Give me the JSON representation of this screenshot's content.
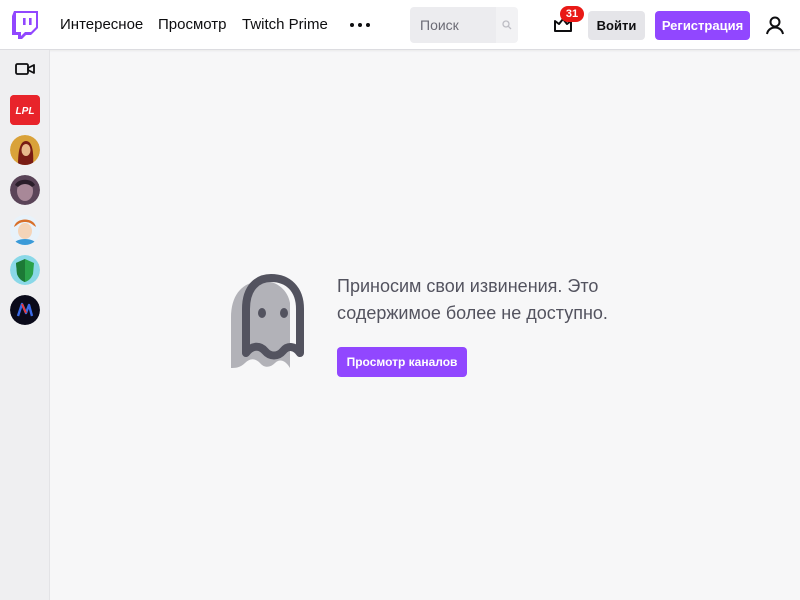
{
  "nav": {
    "links": [
      "Интересное",
      "Просмотр",
      "Twitch Prime"
    ],
    "search_placeholder": "Поиск",
    "notification_count": "31",
    "login_label": "Войти",
    "signup_label": "Регистрация"
  },
  "sidebar": {
    "channels": [
      {
        "icon": "lpl-logo",
        "text": "LPL",
        "color": "#e8242b"
      },
      {
        "icon": "avatar-woman-red",
        "color": "#c83a2a"
      },
      {
        "icon": "avatar-dark-portrait",
        "color": "#6a4a6a"
      },
      {
        "icon": "avatar-anime-blue",
        "color": "#3aa0d8"
      },
      {
        "icon": "avatar-green-shield",
        "color": "#2aa24a"
      },
      {
        "icon": "avatar-dark-logo",
        "color": "#0a0a1a"
      }
    ]
  },
  "main": {
    "message": "Приносим свои извинения. Это содержимое более не доступно.",
    "browse_label": "Просмотр каналов"
  },
  "colors": {
    "brand": "#9147ff",
    "badge": "#e91916",
    "background": "#f7f7f8"
  }
}
